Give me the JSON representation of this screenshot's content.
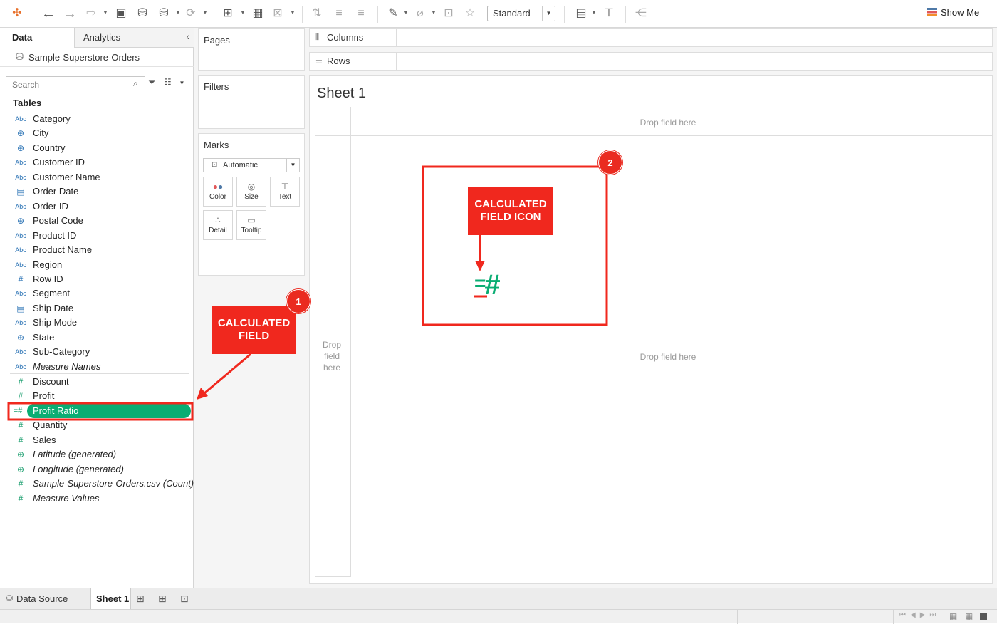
{
  "toolbar": {
    "mark_type_select": "Standard",
    "show_me_label": "Show Me"
  },
  "left_pane": {
    "tab_data": "Data",
    "tab_analytics": "Analytics",
    "datasource": "Sample-Superstore-Orders",
    "search_placeholder": "Search",
    "tables_heading": "Tables",
    "dimensions": [
      {
        "label": "Category",
        "icon": "Abc"
      },
      {
        "label": "City",
        "icon": "globe-icon"
      },
      {
        "label": "Country",
        "icon": "globe-icon"
      },
      {
        "label": "Customer ID",
        "icon": "Abc"
      },
      {
        "label": "Customer Name",
        "icon": "Abc"
      },
      {
        "label": "Order Date",
        "icon": "calendar-icon"
      },
      {
        "label": "Order ID",
        "icon": "Abc"
      },
      {
        "label": "Postal Code",
        "icon": "globe-icon"
      },
      {
        "label": "Product ID",
        "icon": "Abc"
      },
      {
        "label": "Product Name",
        "icon": "Abc"
      },
      {
        "label": "Region",
        "icon": "Abc"
      },
      {
        "label": "Row ID",
        "icon": "hash-icon"
      },
      {
        "label": "Segment",
        "icon": "Abc"
      },
      {
        "label": "Ship Date",
        "icon": "calendar-icon"
      },
      {
        "label": "Ship Mode",
        "icon": "Abc"
      },
      {
        "label": "State",
        "icon": "globe-icon"
      },
      {
        "label": "Sub-Category",
        "icon": "Abc"
      },
      {
        "label": "Measure Names",
        "icon": "Abc"
      }
    ],
    "measures": [
      {
        "label": "Discount",
        "icon": "hash-icon"
      },
      {
        "label": "Profit",
        "icon": "hash-icon"
      },
      {
        "label": "Profit Ratio",
        "icon": "calculated-field-icon"
      },
      {
        "label": "Quantity",
        "icon": "hash-icon"
      },
      {
        "label": "Sales",
        "icon": "hash-icon"
      },
      {
        "label": "Latitude (generated)",
        "icon": "globe-icon"
      },
      {
        "label": "Longitude (generated)",
        "icon": "globe-icon"
      },
      {
        "label": "Sample-Superstore-Orders.csv (Count)",
        "icon": "hash-icon"
      },
      {
        "label": "Measure Values",
        "icon": "hash-icon"
      }
    ]
  },
  "middle_pane": {
    "pages": "Pages",
    "filters": "Filters",
    "marks": "Marks",
    "marks_type": "Automatic",
    "mark_buttons": {
      "color": "Color",
      "size": "Size",
      "text": "Text",
      "detail": "Detail",
      "tooltip": "Tooltip"
    }
  },
  "shelves": {
    "columns": "Columns",
    "rows": "Rows"
  },
  "sheet": {
    "title": "Sheet 1",
    "drop_top": "Drop field here",
    "drop_left": "Drop field here",
    "drop_center": "Drop field here"
  },
  "bottom_tabs": {
    "data_source": "Data Source",
    "sheet1": "Sheet 1"
  },
  "annotations": {
    "callout_1": "CALCULATED FIELD",
    "badge_1": "1",
    "callout_2": "CALCULATED FIELD ICON",
    "badge_2": "2",
    "accent_red": "#f0281e",
    "measure_green": "#0aad73"
  }
}
